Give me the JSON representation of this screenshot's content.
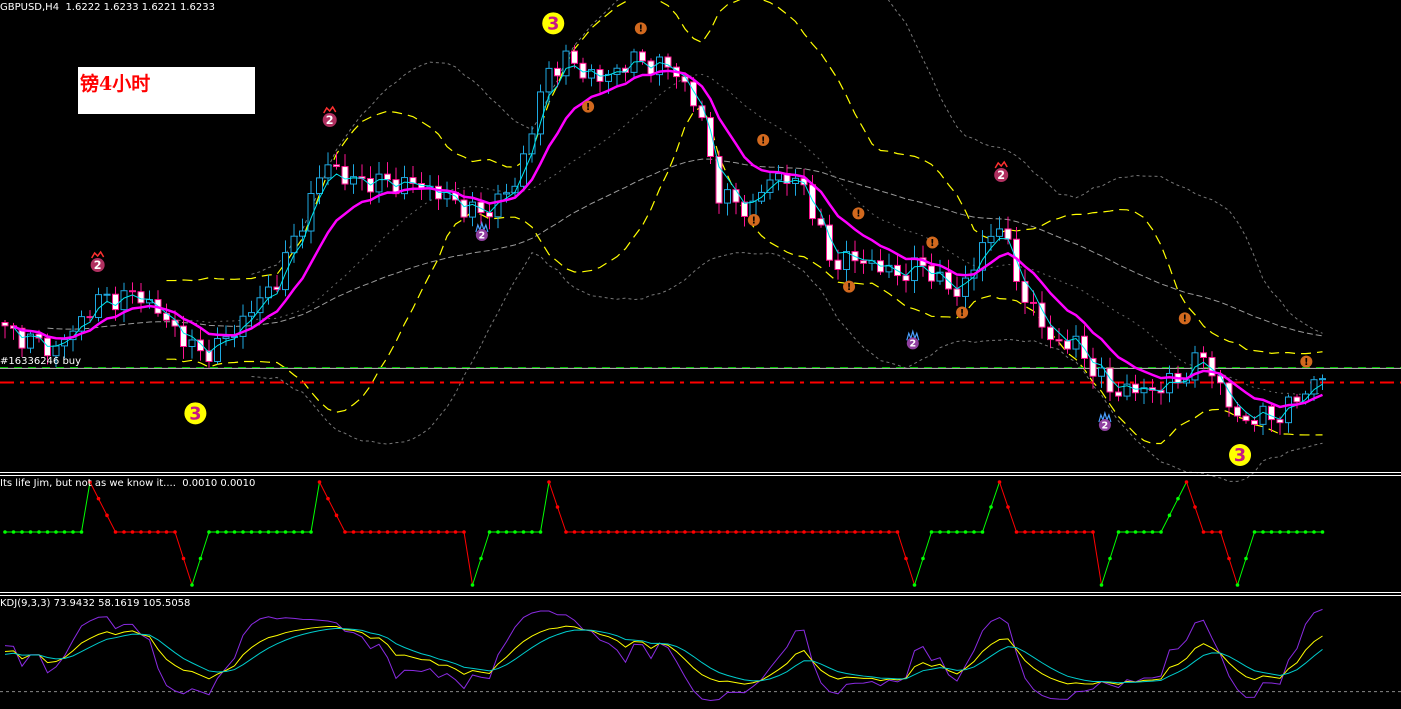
{
  "header": {
    "symbol": "GBPUSD,H4",
    "ohlc": "1.6222 1.6233 1.6221 1.6233"
  },
  "title_box": "镑4小时",
  "order_label": "#16336246 buy",
  "indicator": {
    "label": "Its life Jim, but not as we know it....  0.0010 0.0010"
  },
  "kdj": {
    "label": "KDJ(9,3,3) 73.9432 58.1619 105.5058"
  },
  "colors": {
    "bull": "#1ea8e0",
    "bear": "#ff1493",
    "ma_fast": "#00e5ee",
    "ma_slow": "#ff00ff",
    "band": "#ffff00",
    "outer_band": "#808080",
    "up": "#00ff00",
    "down": "#ff0000",
    "k": "#8a2be2",
    "d": "#ffff00",
    "j_line": "#00cccc"
  },
  "chart_data": {
    "type": "candlestick",
    "symbol": "GBPUSD",
    "timeframe": "H4",
    "ylim": [
      1.6111,
      1.6675
    ],
    "candle_count": 156,
    "close_anchors": [
      [
        0,
        1.6279
      ],
      [
        6,
        1.6255
      ],
      [
        11,
        1.6315
      ],
      [
        16,
        1.6321
      ],
      [
        23,
        1.6249
      ],
      [
        26,
        1.6267
      ],
      [
        32,
        1.6339
      ],
      [
        38,
        1.6483
      ],
      [
        40,
        1.6459
      ],
      [
        49,
        1.6453
      ],
      [
        56,
        1.6417
      ],
      [
        60,
        1.6453
      ],
      [
        64,
        1.6591
      ],
      [
        66,
        1.6603
      ],
      [
        70,
        1.6579
      ],
      [
        74,
        1.6603
      ],
      [
        79,
        1.6591
      ],
      [
        82,
        1.6531
      ],
      [
        84,
        1.6441
      ],
      [
        88,
        1.6423
      ],
      [
        90,
        1.6465
      ],
      [
        94,
        1.6453
      ],
      [
        97,
        1.6363
      ],
      [
        101,
        1.6363
      ],
      [
        105,
        1.6345
      ],
      [
        108,
        1.6357
      ],
      [
        112,
        1.6321
      ],
      [
        117,
        1.6411
      ],
      [
        119,
        1.6339
      ],
      [
        123,
        1.6267
      ],
      [
        126,
        1.6261
      ],
      [
        130,
        1.6207
      ],
      [
        135,
        1.6207
      ],
      [
        138,
        1.6219
      ],
      [
        141,
        1.6249
      ],
      [
        145,
        1.6171
      ],
      [
        150,
        1.6177
      ],
      [
        155,
        1.6225
      ]
    ],
    "price_lines": [
      {
        "name": "current-price",
        "price": 1.6233,
        "color": "#c0c0c0",
        "style": "solid"
      },
      {
        "name": "order-open",
        "price": 1.6234,
        "color": "#00c000",
        "style": "dash"
      },
      {
        "name": "stop-level",
        "price": 1.6216,
        "color": "#ff0000",
        "style": "dashdot"
      }
    ],
    "markers": [
      {
        "type": "three",
        "label": "3",
        "idx": 64.5,
        "price": 1.6647
      },
      {
        "type": "three",
        "label": "3",
        "idx": 22.4,
        "price": 1.6179
      },
      {
        "type": "three",
        "label": "3",
        "idx": 145.3,
        "price": 1.6129
      },
      {
        "type": "sell",
        "label": "2",
        "idx": 38.2,
        "price": 1.6531
      },
      {
        "type": "sell",
        "label": "2",
        "idx": 10.9,
        "price": 1.6357
      },
      {
        "type": "sell",
        "label": "2",
        "idx": 117.2,
        "price": 1.6465
      },
      {
        "type": "buy",
        "label": "2",
        "idx": 56.1,
        "price": 1.6393
      },
      {
        "type": "buy",
        "label": "2",
        "idx": 106.8,
        "price": 1.6263
      },
      {
        "type": "buy",
        "label": "2",
        "idx": 129.4,
        "price": 1.6165
      },
      {
        "type": "alert",
        "label": "!",
        "idx": 74.8,
        "price": 1.6641
      },
      {
        "type": "alert",
        "label": "!",
        "idx": 68.6,
        "price": 1.6547
      },
      {
        "type": "alert",
        "label": "!",
        "idx": 89.2,
        "price": 1.6507
      },
      {
        "type": "alert",
        "label": "!",
        "idx": 88.1,
        "price": 1.6411
      },
      {
        "type": "alert",
        "label": "!",
        "idx": 100.4,
        "price": 1.6419
      },
      {
        "type": "alert",
        "label": "!",
        "idx": 99.3,
        "price": 1.6331
      },
      {
        "type": "alert",
        "label": "!",
        "idx": 109.1,
        "price": 1.6384
      },
      {
        "type": "alert",
        "label": "!",
        "idx": 112.6,
        "price": 1.63
      },
      {
        "type": "alert",
        "label": "!",
        "idx": 153.1,
        "price": 1.6241
      },
      {
        "type": "alert",
        "label": "!",
        "idx": 138.8,
        "price": 1.6293
      }
    ],
    "step_indicator": [
      [
        0,
        0
      ],
      [
        9,
        0
      ],
      [
        10,
        1
      ],
      [
        13,
        0
      ],
      [
        20,
        0
      ],
      [
        22,
        -1
      ],
      [
        24,
        0
      ],
      [
        36,
        0
      ],
      [
        37,
        1
      ],
      [
        40,
        0
      ],
      [
        54,
        0
      ],
      [
        55,
        -1
      ],
      [
        57,
        0
      ],
      [
        63,
        0
      ],
      [
        64,
        1
      ],
      [
        66,
        0
      ],
      [
        105,
        0
      ],
      [
        107,
        -1
      ],
      [
        109,
        0
      ],
      [
        115,
        0
      ],
      [
        117,
        1
      ],
      [
        119,
        0
      ],
      [
        128,
        0
      ],
      [
        129,
        -1
      ],
      [
        131,
        0
      ],
      [
        136,
        0
      ],
      [
        139,
        1
      ],
      [
        141,
        0
      ],
      [
        143,
        0
      ],
      [
        145,
        -1
      ],
      [
        147,
        0
      ],
      [
        155,
        0
      ]
    ],
    "kdj_params": {
      "period": 9,
      "k_smooth": 3,
      "d_smooth": 3,
      "ylim": [
        -20,
        125
      ]
    }
  }
}
